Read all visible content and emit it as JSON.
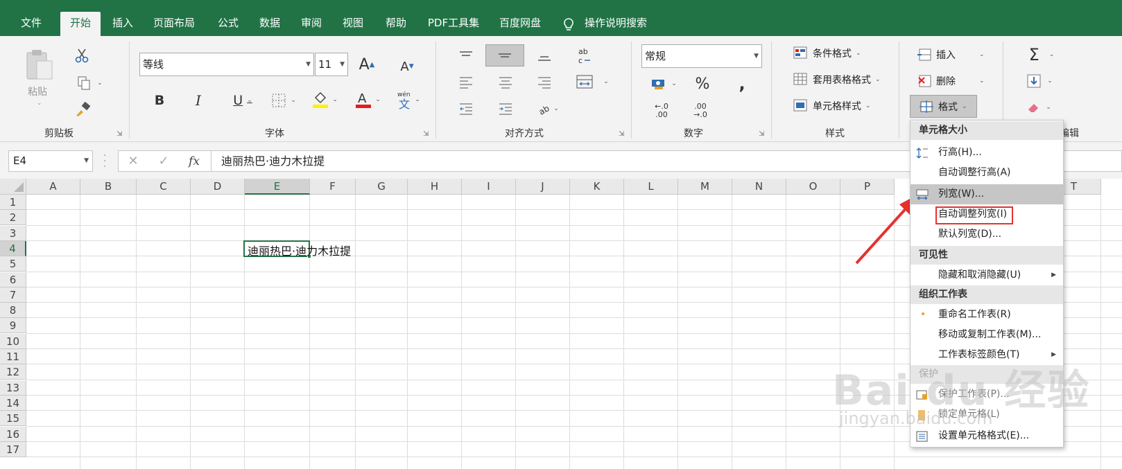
{
  "tabs": [
    "文件",
    "开始",
    "插入",
    "页面布局",
    "公式",
    "数据",
    "审阅",
    "视图",
    "帮助",
    "PDF工具集",
    "百度网盘",
    "操作说明搜索"
  ],
  "ribbon": {
    "clipboard": {
      "paste_label": "粘贴",
      "group": "剪贴板"
    },
    "font": {
      "name": "等线",
      "size": "11",
      "group": "字体"
    },
    "alignment": {
      "group": "对齐方式"
    },
    "number": {
      "format": "常规",
      "group": "数字"
    },
    "styles": {
      "conditional": "条件格式",
      "table": "套用表格格式",
      "cell": "单元格样式",
      "group": "样式"
    },
    "cells": {
      "insert": "插入",
      "delete": "删除",
      "format": "格式"
    },
    "editing": {
      "group": "编辑"
    }
  },
  "formula_bar": {
    "name_box": "E4",
    "value": "迪丽热巴·迪力木拉提"
  },
  "grid": {
    "columns": [
      "A",
      "B",
      "C",
      "D",
      "E",
      "F",
      "G",
      "H",
      "I",
      "J",
      "K",
      "L",
      "M",
      "N",
      "O",
      "P",
      "T"
    ],
    "rows": [
      "1",
      "2",
      "3",
      "4",
      "5",
      "6",
      "7",
      "8",
      "9",
      "10",
      "11",
      "12",
      "13",
      "14",
      "15",
      "16",
      "17"
    ],
    "selected_column": "E",
    "selected_row": "4",
    "cell_text": "迪丽热巴·迪力木拉提"
  },
  "format_menu": {
    "section_size": "单元格大小",
    "row_height": "行高(H)...",
    "autofit_row": "自动调整行高(A)",
    "col_width": "列宽(W)...",
    "autofit_col": "自动调整列宽(I)",
    "default_width": "默认列宽(D)...",
    "section_visibility": "可见性",
    "hide_unhide": "隐藏和取消隐藏(U)",
    "section_organize": "组织工作表",
    "rename": "重命名工作表(R)",
    "move_copy": "移动或复制工作表(M)...",
    "tab_color": "工作表标签颜色(T)",
    "section_protect": "保护",
    "protect_sheet": "保护工作表(P)...",
    "lock_cell": "锁定单元格(L)",
    "format_cells": "设置单元格格式(E)..."
  },
  "watermark": {
    "brand": "Bai du 经验",
    "url": "jingyan.baidu.com"
  },
  "colors": {
    "brand_green": "#217346",
    "highlight_red": "#e5322d"
  }
}
